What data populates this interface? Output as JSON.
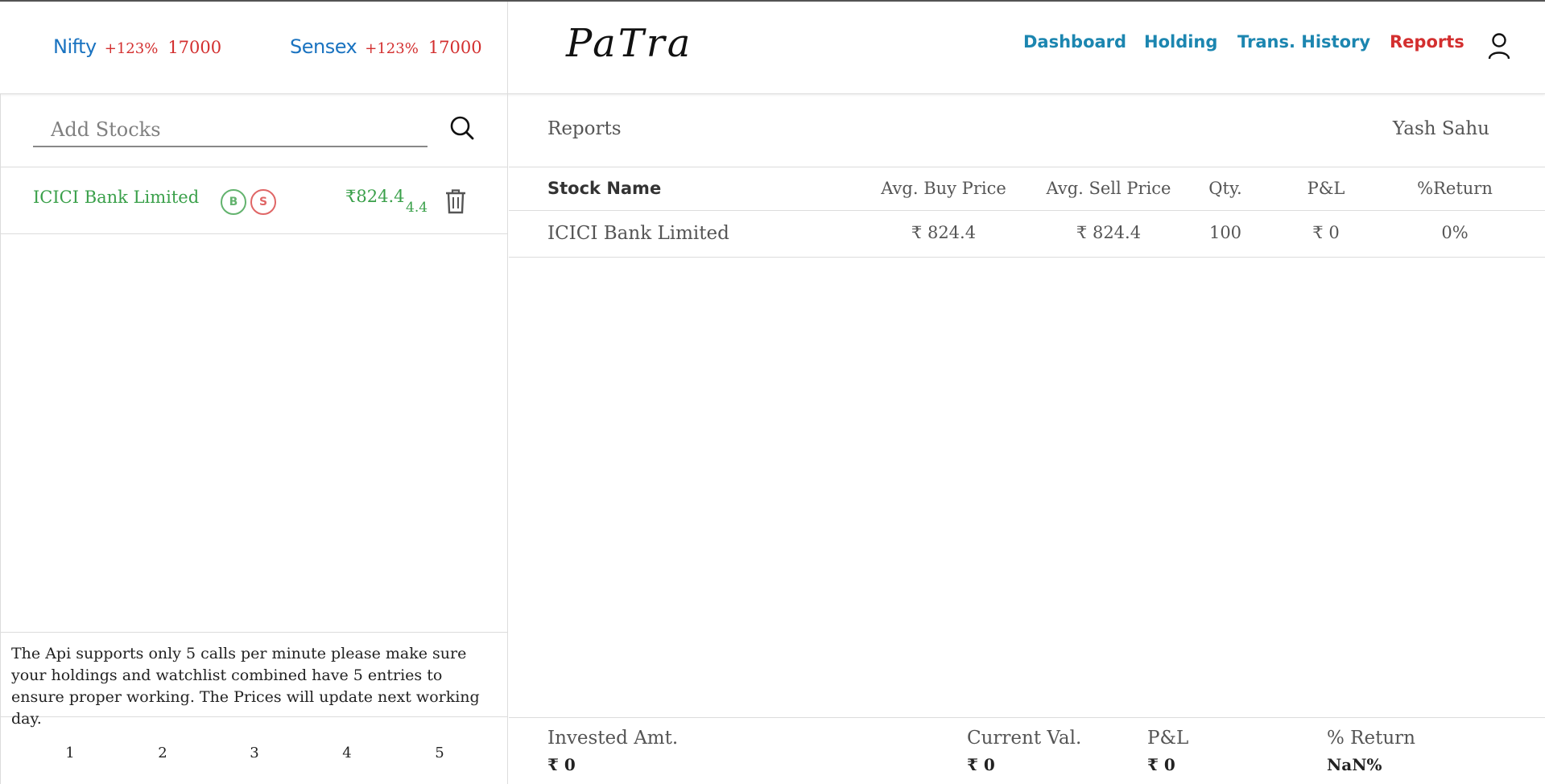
{
  "header": {
    "tickers": [
      {
        "name": "Nifty",
        "change": "+123%",
        "value": "17000"
      },
      {
        "name": "Sensex",
        "change": "+123%",
        "value": "17000"
      }
    ],
    "brand": "PaTra",
    "nav": {
      "dashboard": "Dashboard",
      "holding": "Holding",
      "trans_history": "Trans. History",
      "reports": "Reports"
    },
    "icons": {
      "user": "user-icon"
    },
    "colors": {
      "nav_link": "#1c86b0",
      "nav_active": "#d32f2f",
      "ticker_name": "#1a73c0",
      "ticker_value": "#d32f2f"
    }
  },
  "sidebar": {
    "search": {
      "placeholder": "Add Stocks",
      "value": ""
    },
    "watchlist": [
      {
        "name": "ICICI Bank Limited",
        "buy": "B",
        "sell": "S",
        "price": "₹824.4",
        "change": "4.4"
      }
    ],
    "notice": "The Api supports only 5 calls per minute please make sure your holdings and watchlist combined have 5 entries to ensure proper working. The Prices will update next working day.",
    "pages": [
      "1",
      "2",
      "3",
      "4",
      "5"
    ],
    "colors": {
      "positive": "#3aa04a",
      "buy": "#63b36e",
      "sell": "#e06666"
    }
  },
  "main": {
    "title": "Reports",
    "user": "Yash Sahu",
    "table": {
      "columns": [
        "Stock Name",
        "Avg. Buy Price",
        "Avg. Sell Price",
        "Qty.",
        "P&L",
        "%Return"
      ],
      "rows": [
        {
          "name": "ICICI Bank Limited",
          "avg_buy": "₹ 824.4",
          "avg_sell": "₹ 824.4",
          "qty": "100",
          "pl": "₹ 0",
          "ret": "0%"
        }
      ]
    },
    "summary": {
      "invested": {
        "label": "Invested Amt.",
        "value": "₹  0"
      },
      "current": {
        "label": "Current Val.",
        "value": "₹  0"
      },
      "pl": {
        "label": "P&L",
        "value": "₹  0"
      },
      "ret": {
        "label": "% Return",
        "value": "NaN%"
      }
    }
  }
}
